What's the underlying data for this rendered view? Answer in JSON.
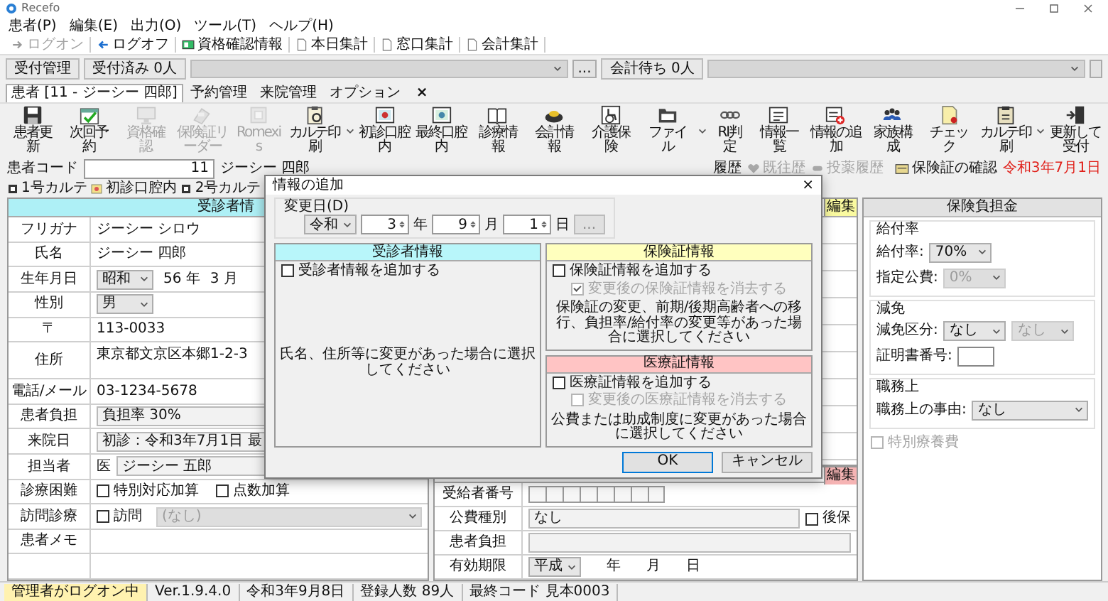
{
  "window": {
    "title": "Recefo"
  },
  "menu": [
    "患者(P)",
    "編集(E)",
    "出力(O)",
    "ツール(T)",
    "ヘルプ(H)"
  ],
  "quick_toolbar": [
    {
      "label": "ログオン",
      "disabled": true
    },
    {
      "label": "ログオフ",
      "disabled": false
    },
    {
      "label": "資格確認情報",
      "disabled": false
    },
    {
      "label": "本日集計",
      "disabled": false
    },
    {
      "label": "窓口集計",
      "disabled": false
    },
    {
      "label": "会計集計",
      "disabled": false
    }
  ],
  "reception": {
    "tab": "受付管理",
    "accepted": "受付済み 0人",
    "more_button": "...",
    "waiting": "会計待ち 0人"
  },
  "tabs": [
    {
      "label": "患者 [11 - ジーシー 四郎]",
      "selected": true
    },
    {
      "label": "予約管理",
      "selected": false
    },
    {
      "label": "来院管理",
      "selected": false
    },
    {
      "label": "オプション",
      "selected": false
    }
  ],
  "tab_close": "×",
  "toolbar": [
    {
      "label": "患者更新",
      "disabled": false,
      "has_menu": false
    },
    {
      "label": "次回予約",
      "disabled": false,
      "has_menu": false
    },
    {
      "label": "資格確認",
      "disabled": true,
      "has_menu": false
    },
    {
      "label": "保険証リーダー",
      "disabled": true,
      "has_menu": false
    },
    {
      "label": "Romexis",
      "disabled": true,
      "has_menu": false
    },
    {
      "label": "カルテ印刷",
      "disabled": false,
      "has_menu": true
    },
    {
      "label": "初診口腔内",
      "disabled": false,
      "has_menu": false
    },
    {
      "label": "最終口腔内",
      "disabled": false,
      "has_menu": false
    },
    {
      "label": "診療情報",
      "disabled": false,
      "has_menu": false
    },
    {
      "label": "会計情報",
      "disabled": false,
      "has_menu": false
    },
    {
      "label": "介護保険",
      "disabled": false,
      "has_menu": false
    },
    {
      "label": "ファイル",
      "disabled": false,
      "has_menu": true
    },
    {
      "label": "RI判定",
      "disabled": false,
      "has_menu": false
    },
    {
      "label": "情報一覧",
      "disabled": false,
      "has_menu": false
    },
    {
      "label": "情報の追加",
      "disabled": false,
      "has_menu": false
    },
    {
      "label": "家族構成",
      "disabled": false,
      "has_menu": false
    },
    {
      "label": "チェック",
      "disabled": false,
      "has_menu": false
    },
    {
      "label": "カルテ印刷",
      "disabled": false,
      "has_menu": true
    },
    {
      "label": "更新して受付",
      "disabled": false,
      "has_menu": false
    }
  ],
  "patient_code": {
    "label": "患者コード",
    "value": "11",
    "name": "ジーシー 四郎"
  },
  "history_links": [
    {
      "label": "履歴",
      "disabled": false
    },
    {
      "label": "既往歴",
      "disabled": true
    },
    {
      "label": "投薬履歴",
      "disabled": true
    }
  ],
  "insurance_check": "保険証の確認",
  "visit_date": "令和3年7月1日",
  "chart_tabs": [
    "1号カルテ",
    "初診口腔内",
    "2号カルテ"
  ],
  "patient_panel": {
    "header": "受診者情",
    "rows": [
      {
        "label": "フリガナ",
        "kind": "text",
        "value": "ジーシー シロウ"
      },
      {
        "label": "氏名",
        "kind": "text",
        "value": "ジーシー 四郎"
      },
      {
        "label": "生年月日",
        "kind": "birth",
        "era": "昭和",
        "parts": [
          "56 年",
          "3 月"
        ]
      },
      {
        "label": "性別",
        "kind": "select",
        "value": "男"
      },
      {
        "label": "〒",
        "kind": "text",
        "value": "113-0033"
      },
      {
        "label": "住所",
        "kind": "address",
        "value": "東京都文京区本郷1-2-3"
      },
      {
        "label": "電話/メール",
        "kind": "text",
        "value": "03-1234-5678"
      },
      {
        "label": "患者負担",
        "kind": "field",
        "value": "負担率 30%"
      },
      {
        "label": "来院日",
        "kind": "field",
        "value": "初診：令和3年7月1日 最"
      },
      {
        "label": "担当者",
        "kind": "staff",
        "prefix": "医",
        "value": "ジーシー 五郎"
      },
      {
        "label": "診療困難",
        "kind": "checks",
        "checks": [
          {
            "label": "特別対応加算",
            "checked": false
          },
          {
            "label": "点数加算",
            "checked": false
          }
        ]
      },
      {
        "label": "訪問診療",
        "kind": "visit",
        "check": {
          "label": "訪問",
          "checked": false
        },
        "value": "(なし)",
        "disabled": true
      },
      {
        "label": "患者メモ",
        "kind": "empty"
      }
    ]
  },
  "insurance_panel": {
    "edit_button": "編集"
  },
  "medical_panel": {
    "edit_button": "編集",
    "rows": [
      {
        "label": "受給者番号",
        "kind": "digits"
      },
      {
        "label": "公費種別",
        "kind": "field_check",
        "value": "なし",
        "check": {
          "label": "後保",
          "checked": false
        }
      },
      {
        "label": "患者負担",
        "kind": "field"
      },
      {
        "label": "有効期限",
        "kind": "date",
        "era": "平成",
        "units": [
          "年",
          "月",
          "日"
        ]
      }
    ]
  },
  "burden_panel": {
    "header": "保険負担金",
    "groups": [
      {
        "title": "給付率",
        "rows": [
          {
            "label": "給付率:",
            "kind": "select",
            "selects": [
              {
                "value": "70%",
                "disabled": false
              }
            ]
          },
          {
            "label": "指定公費:",
            "kind": "select",
            "selects": [
              {
                "value": "0%",
                "disabled": true
              }
            ]
          }
        ]
      },
      {
        "title": "減免",
        "rows": [
          {
            "label": "減免区分:",
            "kind": "select",
            "selects": [
              {
                "value": "なし",
                "disabled": false
              },
              {
                "value": "なし",
                "disabled": true
              }
            ]
          },
          {
            "label": "証明書番号:",
            "kind": "field"
          }
        ]
      },
      {
        "title": "職務上",
        "rows": [
          {
            "label": "職務上の事由:",
            "kind": "wide_select",
            "selects": [
              {
                "value": "なし",
                "disabled": false
              }
            ]
          }
        ]
      }
    ],
    "special_check": {
      "label": "特別療養費",
      "checked": false,
      "disabled": true
    }
  },
  "dialog": {
    "title": "情報の追加",
    "close": "×",
    "date_group": {
      "legend": "変更日(D)",
      "era": "令和",
      "fields": [
        {
          "value": "3",
          "unit": "年"
        },
        {
          "value": "9",
          "unit": "月"
        },
        {
          "value": "1",
          "unit": "日"
        }
      ],
      "picker_button": "..."
    },
    "panels": [
      {
        "title": "受診者情報",
        "color": "#b8f6fa",
        "checks": [
          {
            "label": "受診者情報を追加する",
            "checked": false,
            "disabled": false
          }
        ],
        "note": "氏名、住所等に変更があった場合に選択してください"
      },
      {
        "title": "保険証情報",
        "color": "#ffffbe",
        "checks": [
          {
            "label": "保険証情報を追加する",
            "checked": false,
            "disabled": false
          },
          {
            "label": "変更後の保険証情報を消去する",
            "checked": true,
            "disabled": true
          }
        ],
        "note": "保険証の変更、前期/後期高齢者への移行、負担率/給付率の変更等があった場合に選択してください"
      },
      {
        "title": "医療証情報",
        "color": "#ffc4c4",
        "checks": [
          {
            "label": "医療証情報を追加する",
            "checked": false,
            "disabled": false
          },
          {
            "label": "変更後の医療証情報を消去する",
            "checked": false,
            "disabled": true
          }
        ],
        "note": "公費または助成制度に変更があった場合に選択してください"
      }
    ],
    "buttons": [
      {
        "label": "OK",
        "default": true
      },
      {
        "label": "キャンセル",
        "default": false
      }
    ]
  },
  "status_bar": [
    "管理者がログオン中",
    "Ver.1.9.4.0",
    "令和3年9月8日",
    "登録人数 89人",
    "最終コード 見本0003"
  ]
}
